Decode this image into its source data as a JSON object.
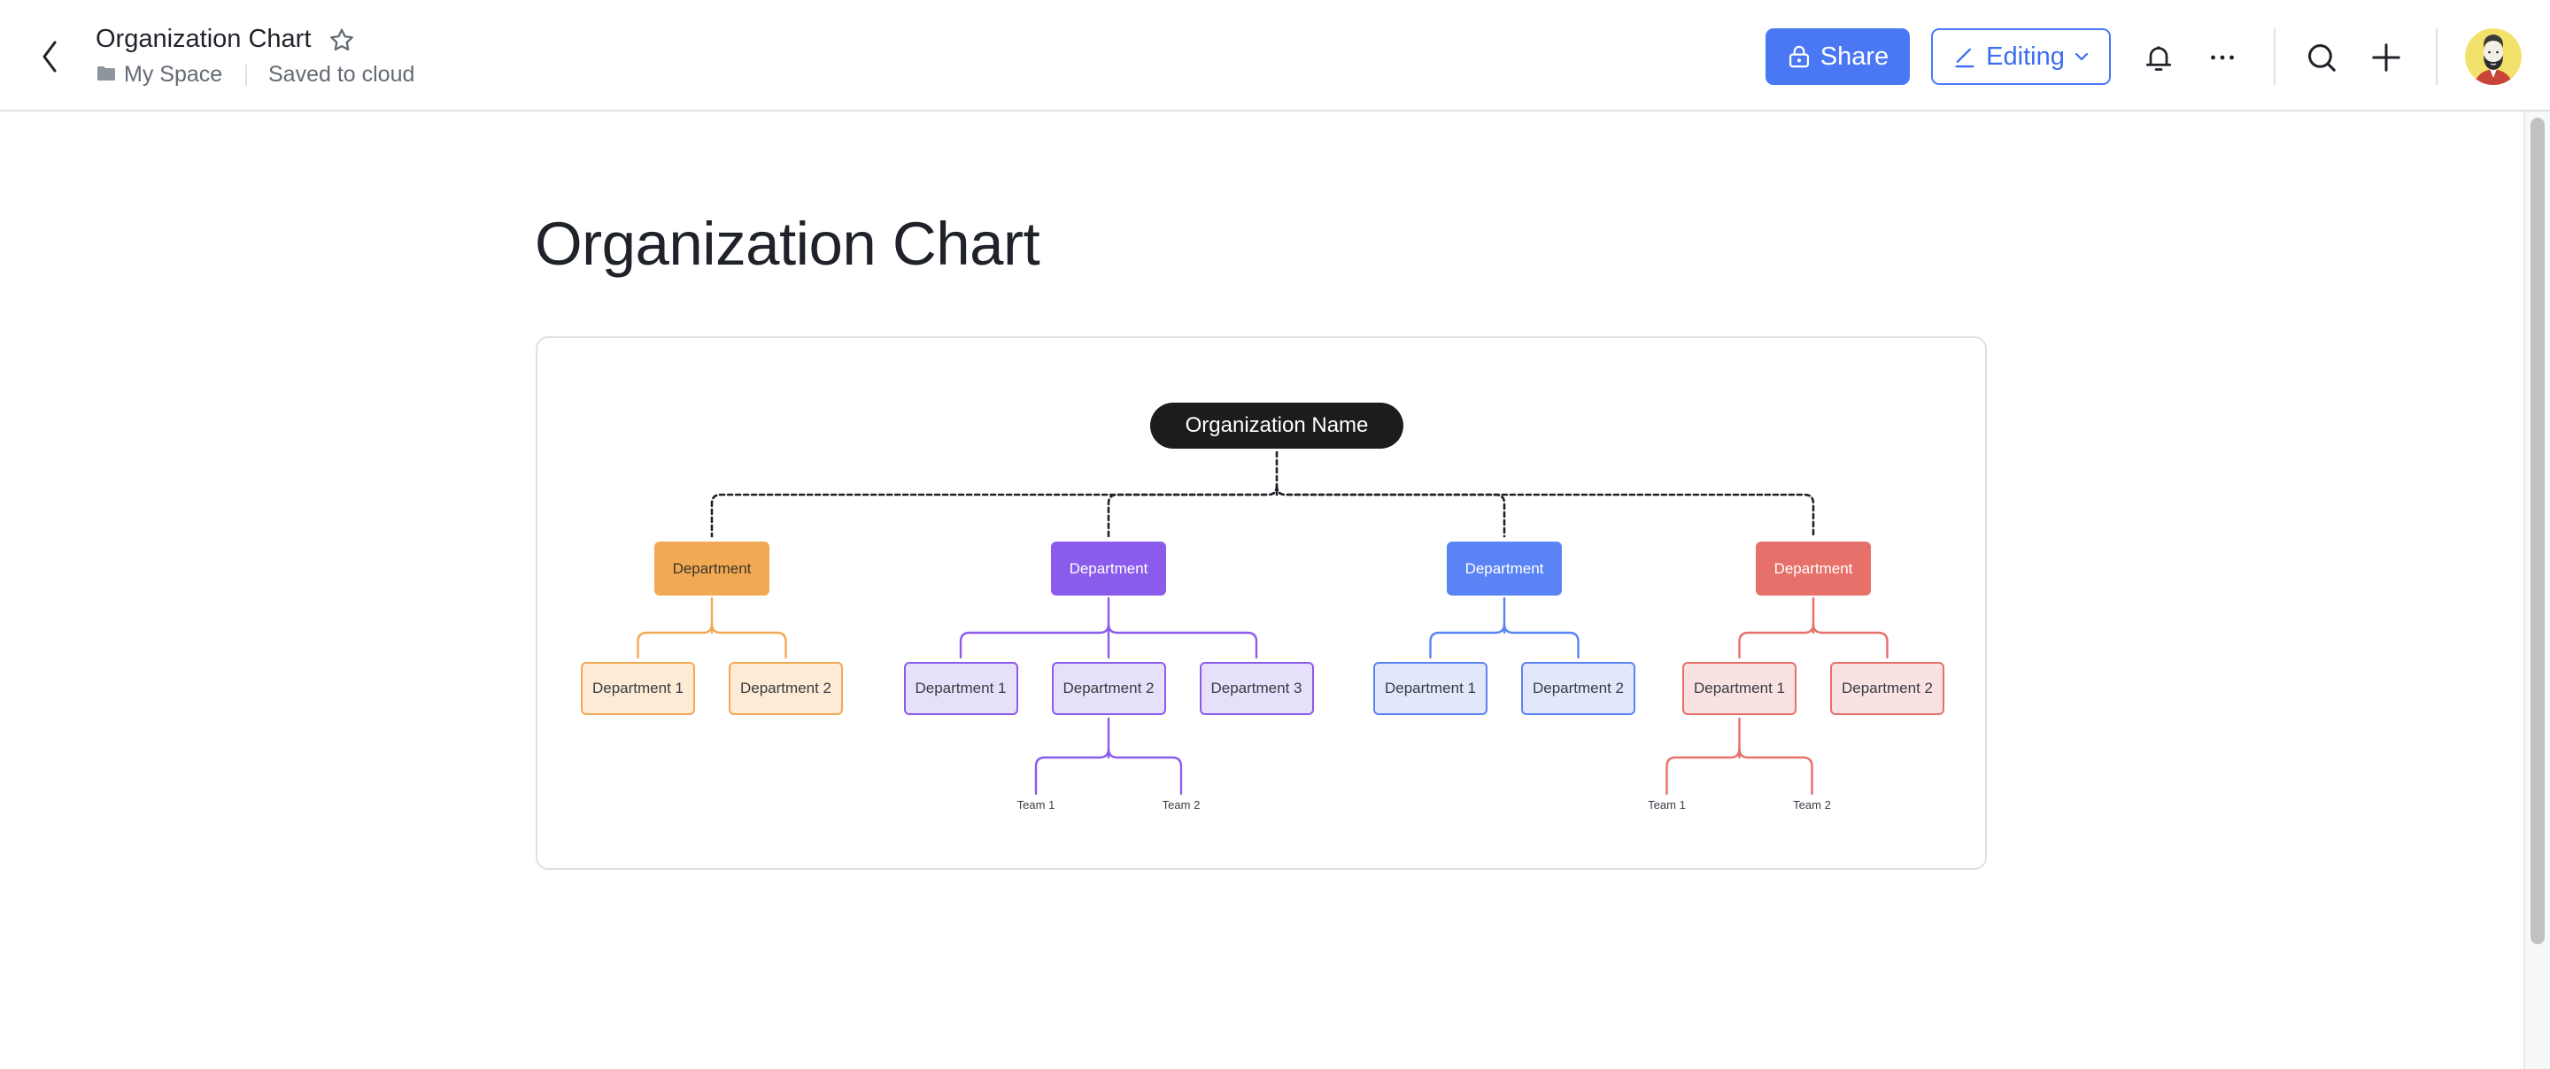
{
  "header": {
    "title": "Organization Chart",
    "location": "My Space",
    "status": "Saved to cloud",
    "share_label": "Share",
    "editing_label": "Editing",
    "icons": {
      "back": "chevron-left-icon",
      "favorite": "star-icon",
      "folder": "folder-icon",
      "share": "lock-icon",
      "editing": "pencil-icon",
      "dropdown": "chevron-down-icon",
      "notifications": "bell-icon",
      "more": "more-icon",
      "search": "search-icon",
      "add": "plus-icon"
    }
  },
  "colors": {
    "accent": "#4a78f5",
    "root": "#1c1c1e",
    "connector": "#1f2329"
  },
  "page": {
    "title": "Organization Chart"
  },
  "chart_data": {
    "type": "org-chart",
    "root": "Organization Name",
    "departments": [
      {
        "name": "Department",
        "color": "#f2a953",
        "text_color": "#3b3428",
        "sub_fill": "#fdebd6",
        "children": [
          {
            "name": "Department 1",
            "teams": []
          },
          {
            "name": "Department 2",
            "teams": []
          }
        ]
      },
      {
        "name": "Department",
        "color": "#8b5ceb",
        "text_color": "#ffffff",
        "sub_fill": "#e6e0fa",
        "children": [
          {
            "name": "Department 1",
            "teams": []
          },
          {
            "name": "Department 2",
            "teams": [
              "Team 1",
              "Team 2"
            ]
          },
          {
            "name": "Department 3",
            "teams": []
          }
        ]
      },
      {
        "name": "Department",
        "color": "#5a84f5",
        "text_color": "#ffffff",
        "sub_fill": "#e1e8fc",
        "children": [
          {
            "name": "Department 1",
            "teams": []
          },
          {
            "name": "Department 2",
            "teams": []
          }
        ]
      },
      {
        "name": "Department",
        "color": "#e6706a",
        "text_color": "#ffffff",
        "sub_fill": "#f9e2e1",
        "children": [
          {
            "name": "Department 1",
            "teams": [
              "Team 1",
              "Team 2"
            ]
          },
          {
            "name": "Department 2",
            "teams": []
          }
        ]
      }
    ]
  }
}
